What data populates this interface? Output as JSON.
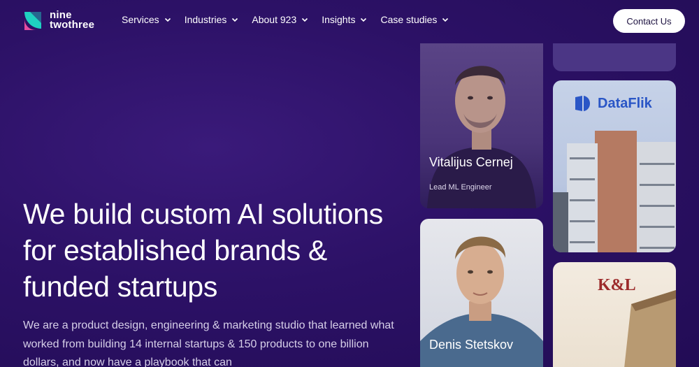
{
  "brand": {
    "line1": "nine",
    "line2": "twothree",
    "colors": {
      "teal": "#1fd1c1",
      "pink": "#e64ca0",
      "purple": "#2c1166"
    }
  },
  "nav": {
    "items": [
      {
        "label": "Services"
      },
      {
        "label": "Industries"
      },
      {
        "label": "About 923"
      },
      {
        "label": "Insights"
      },
      {
        "label": "Case studies"
      }
    ],
    "contact_label": "Contact Us"
  },
  "hero": {
    "title": "We build custom AI solutions for established brands & funded startups",
    "subtitle": "We are a product design, engineering & marketing studio that learned what worked from building 14 internal startups & 150 products to one billion dollars, and now have a playbook that can"
  },
  "cards": {
    "person1": {
      "name": "Vitalijus Cernej",
      "role": "Lead ML Engineer"
    },
    "person2": {
      "name": "Denis Stetskov"
    },
    "dataflik": {
      "brand": "DataFlik"
    },
    "kl": {
      "brand": "K&L"
    }
  }
}
